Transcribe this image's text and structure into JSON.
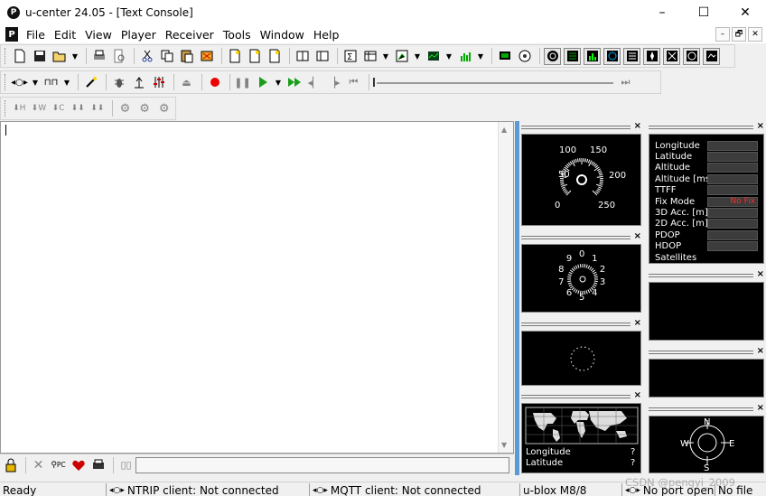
{
  "window": {
    "title": "u-center 24.05 - [Text Console]",
    "app_logo": "P"
  },
  "window_controls": {
    "minimize": "–",
    "maximize": "☐",
    "close": "✕"
  },
  "menu": {
    "logo": "P",
    "items": [
      "File",
      "Edit",
      "View",
      "Player",
      "Receiver",
      "Tools",
      "Window",
      "Help"
    ],
    "mdi": {
      "minimize": "–",
      "restore": "🗗",
      "close": "✕"
    }
  },
  "toolbars": {
    "main": [
      "new-file-icon",
      "save-icon",
      "open-icon",
      "print-icon",
      "print-preview-icon",
      "cut-icon",
      "copy-icon",
      "paste-icon",
      "clear-icon"
    ],
    "player": [
      "play-icon",
      "fast-forward-icon",
      "rewind-icon",
      "step-back-icon",
      "step-forward-icon",
      "to-end-icon"
    ]
  },
  "console": {
    "text": ""
  },
  "views": {
    "speedometer": {
      "ticks": [
        "0",
        "50",
        "100",
        "150",
        "200",
        "250"
      ]
    },
    "compass_dial": {
      "ticks": [
        "0",
        "1",
        "2",
        "3",
        "4",
        "5",
        "6",
        "7",
        "8",
        "9"
      ]
    },
    "world_map": {
      "longitude_label": "Longitude",
      "latitude_label": "Latitude",
      "longitude_value": "?",
      "latitude_value": "?"
    },
    "compass": {
      "n": "N",
      "e": "E",
      "s": "S",
      "w": "W"
    },
    "data": {
      "rows": [
        {
          "label": "Longitude",
          "value": ""
        },
        {
          "label": "Latitude",
          "value": ""
        },
        {
          "label": "Altitude",
          "value": ""
        },
        {
          "label": "Altitude [msl]",
          "value": ""
        },
        {
          "label": "TTFF",
          "value": ""
        },
        {
          "label": "Fix Mode",
          "value": "No Fix"
        },
        {
          "label": "3D Acc. [m]",
          "value": ""
        },
        {
          "label": "2D Acc. [m]",
          "value": ""
        },
        {
          "label": "PDOP",
          "value": ""
        },
        {
          "label": "HDOP",
          "value": ""
        },
        {
          "label": "Satellites",
          "value": ""
        }
      ]
    }
  },
  "statusbar": {
    "ready": "Ready",
    "ntrip": "NTRIP client: Not connected",
    "mqtt": "MQTT client: Not connected",
    "receiver": "u-blox M8/8",
    "port": "No port open",
    "file": "No file"
  },
  "watermark": "CSDN @pengyi_2009",
  "colors": {
    "accent_splitter": "#5b9bd5",
    "fix_red": "#ff2a2a",
    "view_bg": "#000000"
  }
}
